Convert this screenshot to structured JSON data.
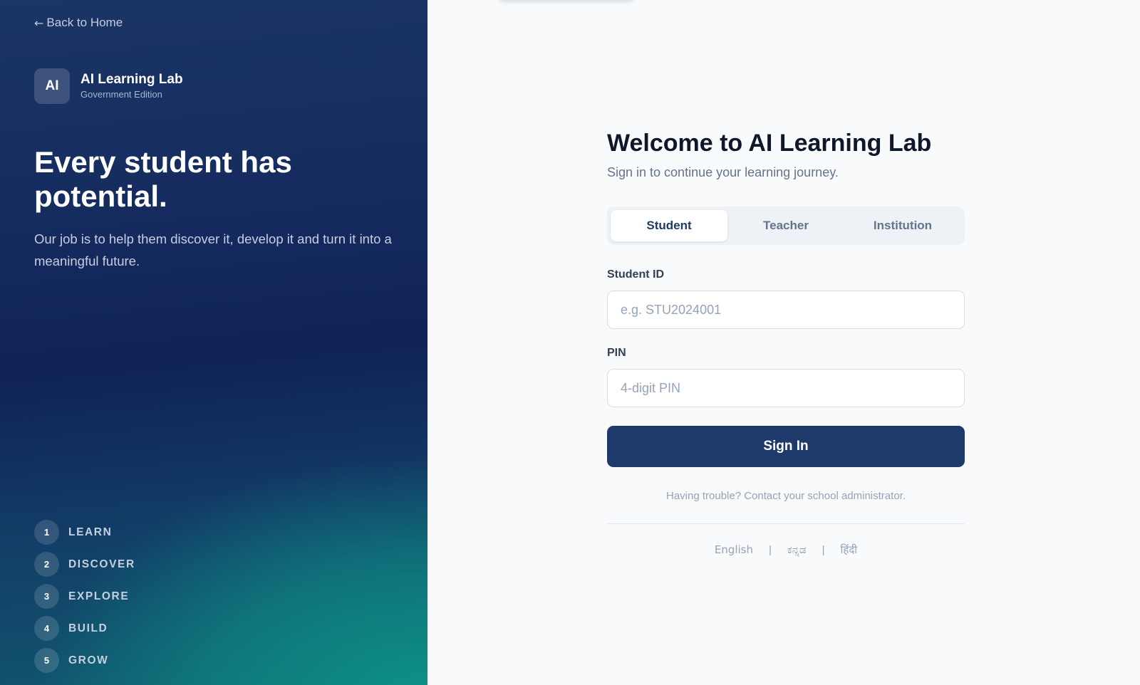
{
  "nav": {
    "back_arrow": "←",
    "back_label": "Back to Home"
  },
  "brand": {
    "logo_text": "AI",
    "name": "AI Learning Lab",
    "edition": "Government Edition"
  },
  "hero": {
    "title": "Every student has potential.",
    "text": "Our job is to help them discover it, develop it and turn it into a meaningful future."
  },
  "steps": [
    {
      "number": "1",
      "label": "LEARN"
    },
    {
      "number": "2",
      "label": "DISCOVER"
    },
    {
      "number": "3",
      "label": "EXPLORE"
    },
    {
      "number": "4",
      "label": "BUILD"
    },
    {
      "number": "5",
      "label": "GROW"
    }
  ],
  "login": {
    "title": "Welcome to AI Learning Lab",
    "subtitle": "Sign in to continue your learning journey.",
    "tabs": [
      {
        "label": "Student",
        "active": true
      },
      {
        "label": "Teacher",
        "active": false
      },
      {
        "label": "Institution",
        "active": false
      }
    ],
    "student_id": {
      "label": "Student ID",
      "value": "",
      "placeholder": "e.g. STU2024001"
    },
    "pin": {
      "label": "PIN",
      "value": "",
      "placeholder": "4-digit PIN"
    },
    "submit_label": "Sign In",
    "help_text": "Having trouble? Contact your school administrator."
  },
  "languages": {
    "items": [
      "English",
      "ಕನ್ನಡ",
      "हिंदी"
    ],
    "separator": "|",
    "selected": "English"
  },
  "colors": {
    "primary": "#1e3a6b",
    "panel_top": "#1b3566",
    "panel_accent": "#0d9488",
    "page_background": "#f8fafc",
    "heading": "#0f172a",
    "muted": "#64748b"
  }
}
